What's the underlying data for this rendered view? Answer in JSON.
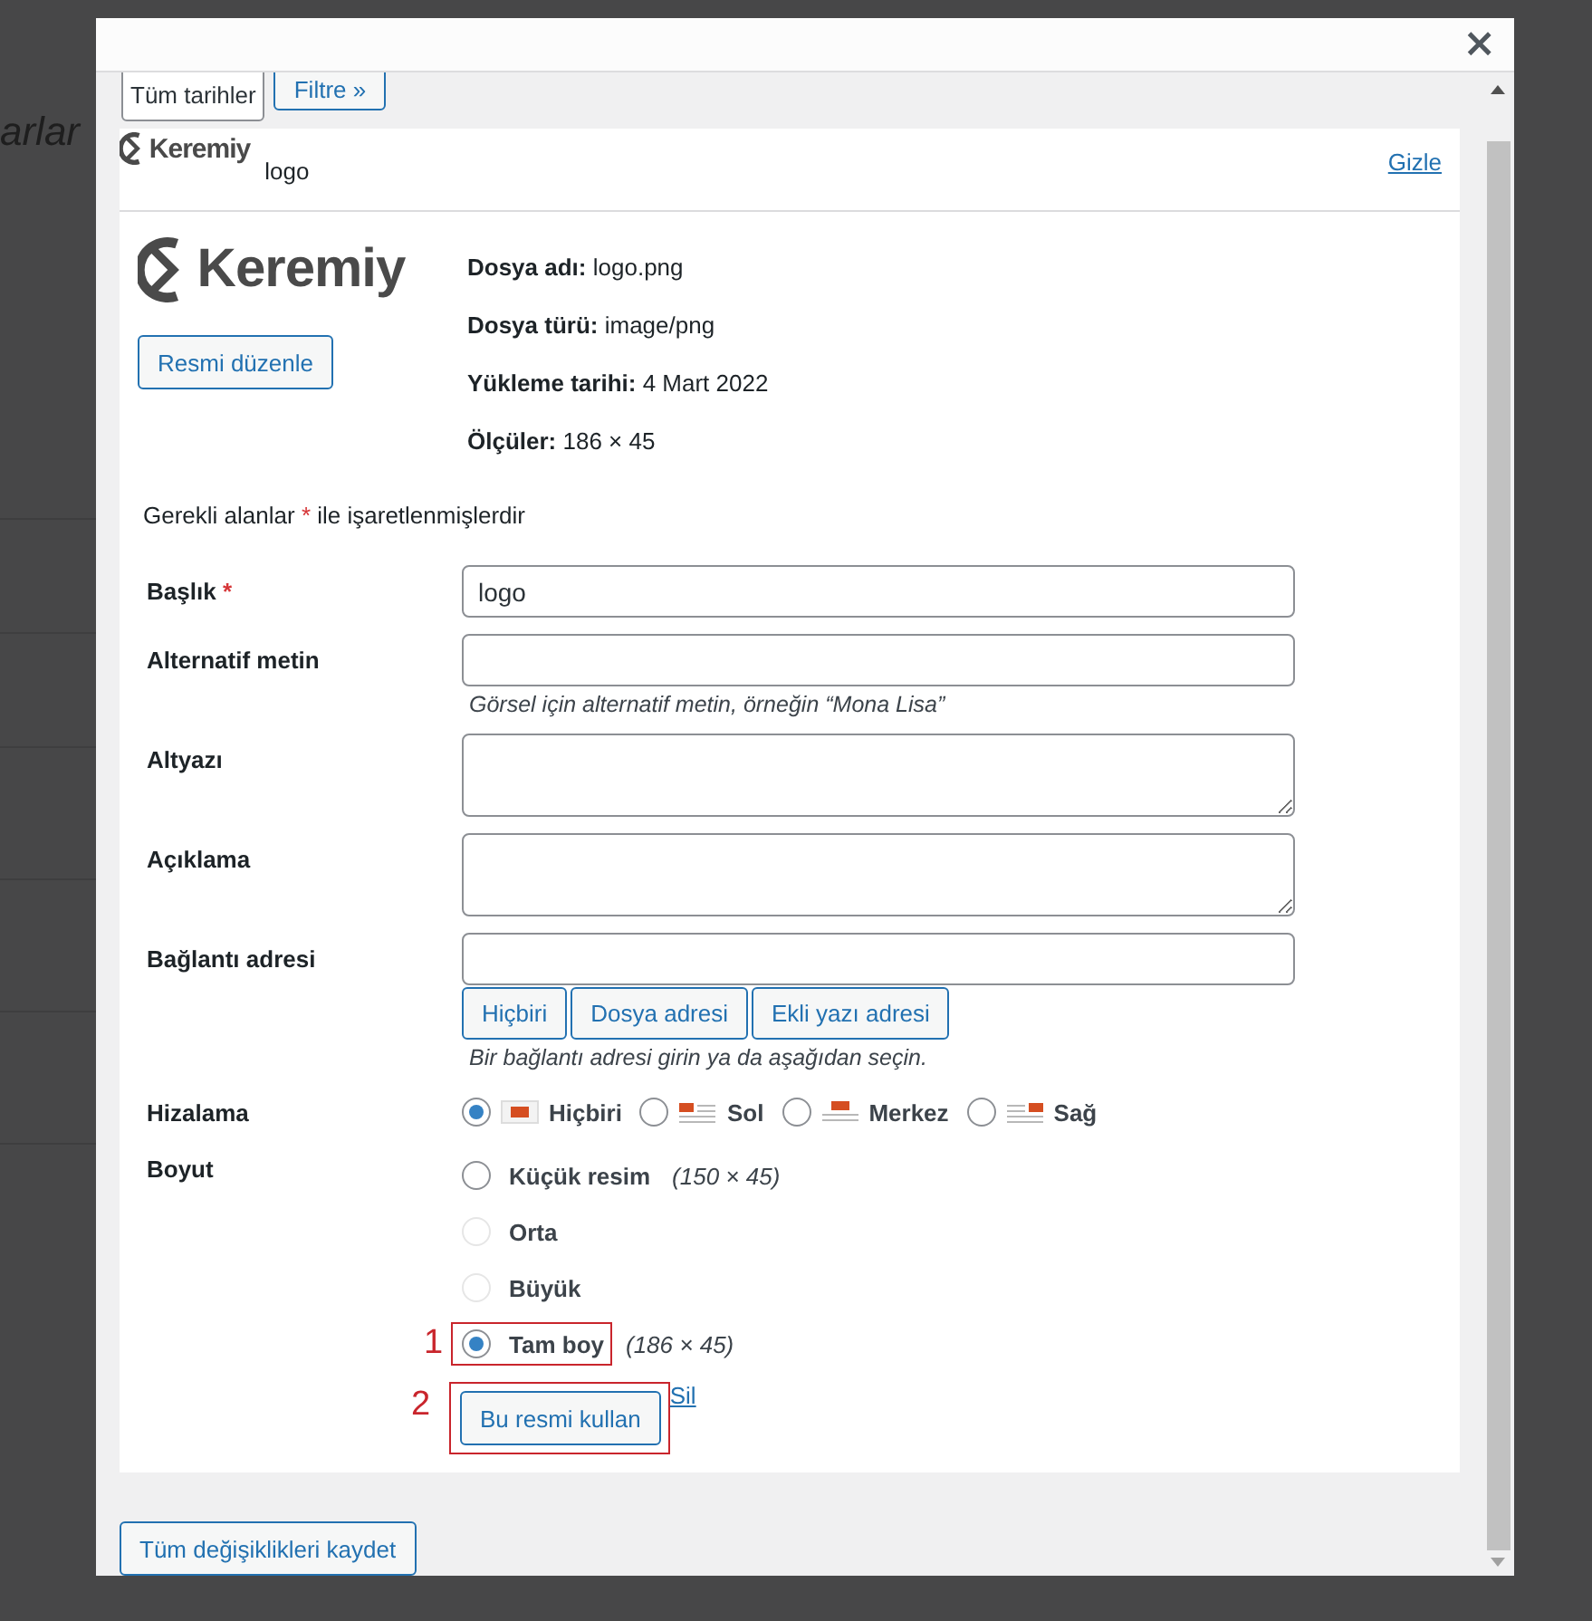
{
  "background": {
    "heading": "arlar"
  },
  "modal": {
    "close": "×"
  },
  "filter_bar": {
    "date_select": "Tüm tarihler",
    "filter_button": "Filtre »"
  },
  "attachment": {
    "logo_text": "Keremiy",
    "title": "logo",
    "hide_link": "Gizle"
  },
  "preview": {
    "logo_text": "Keremiy",
    "edit_button": "Resmi düzenle"
  },
  "details": [
    {
      "label": "Dosya adı:",
      "value": "logo.png"
    },
    {
      "label": "Dosya türü:",
      "value": "image/png"
    },
    {
      "label": "Yükleme tarihi:",
      "value": "4 Mart 2022"
    },
    {
      "label": "Ölçüler:",
      "value": "186 × 45"
    }
  ],
  "required_note": {
    "before": "Gerekli alanlar",
    "star": "*",
    "after": "ile işaretlenmişlerdir"
  },
  "fields": [
    {
      "label": "Başlık",
      "required": true,
      "kind": "input",
      "value": "logo"
    },
    {
      "label": "Alternatif metin",
      "required": false,
      "kind": "input",
      "hint": "Görsel için alternatif metin, örneğin “Mona Lisa”"
    },
    {
      "label": "Altyazı",
      "required": false,
      "kind": "textarea"
    },
    {
      "label": "Açıklama",
      "required": false,
      "kind": "textarea"
    },
    {
      "label": "Bağlantı adresi",
      "required": false,
      "kind": "link",
      "buttons": [
        "Hiçbiri",
        "Dosya adresi",
        "Ekli yazı adresi"
      ],
      "hint": "Bir bağlantı adresi girin ya da aşağıdan seçin."
    }
  ],
  "alignment": {
    "label": "Hizalama",
    "options": [
      {
        "label": "Hiçbiri",
        "kind": "none",
        "selected": true
      },
      {
        "label": "Sol",
        "kind": "left",
        "selected": false
      },
      {
        "label": "Merkez",
        "kind": "center",
        "selected": false
      },
      {
        "label": "Sağ",
        "kind": "right",
        "selected": false
      }
    ]
  },
  "size": {
    "label": "Boyut",
    "options": [
      {
        "label": "Küçük resim",
        "dims": "(150 × 45)",
        "selected": false,
        "disabled": false
      },
      {
        "label": "Orta",
        "selected": false,
        "disabled": true
      },
      {
        "label": "Büyük",
        "selected": false,
        "disabled": true
      },
      {
        "label": "Tam boy",
        "dims": "(186 × 45)",
        "selected": true,
        "disabled": false,
        "annotation": "1"
      }
    ]
  },
  "actions": {
    "use_button": "Bu resmi kullan",
    "use_annotation": "2",
    "delete_link": "Sil"
  },
  "footer": {
    "save_button": "Tüm değişiklikleri kaydet"
  }
}
